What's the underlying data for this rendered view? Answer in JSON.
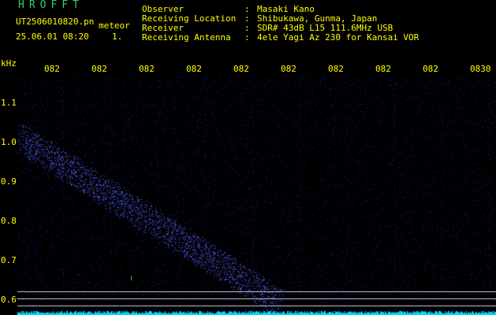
{
  "header": {
    "app_name": "HROFFT",
    "file_name": "UT2506010820.pn",
    "mode": "meteor",
    "datetime": "25.06.01 08:20",
    "page": "1."
  },
  "metadata": [
    {
      "label": "Observer",
      "value": "Masaki Kano"
    },
    {
      "label": "Receiving Location",
      "value": "Shibukawa, Gunma, Japan"
    },
    {
      "label": "Receiver",
      "value": "SDR# 43dB L15 111.6MHz USB"
    },
    {
      "label": "Receiving Antenna",
      "value": "4ele Yagi Az 230 for Kansai VOR"
    }
  ],
  "axes": {
    "y_unit": "kHz",
    "x_ticks": [
      "082",
      "082",
      "082",
      "082",
      "082",
      "082",
      "082",
      "082",
      "082",
      "0830"
    ],
    "y_ticks": [
      "1.1",
      "1.0",
      "0.9",
      "0.8",
      "0.7",
      "0.6"
    ]
  },
  "colors": {
    "background": "#000000",
    "text": "#ffff00",
    "title": "#2fd15a",
    "noise": "#1a1aa8",
    "signal": "#4a5cff",
    "baseline": "#00e0ff",
    "lines": "#b8b8d0"
  }
}
